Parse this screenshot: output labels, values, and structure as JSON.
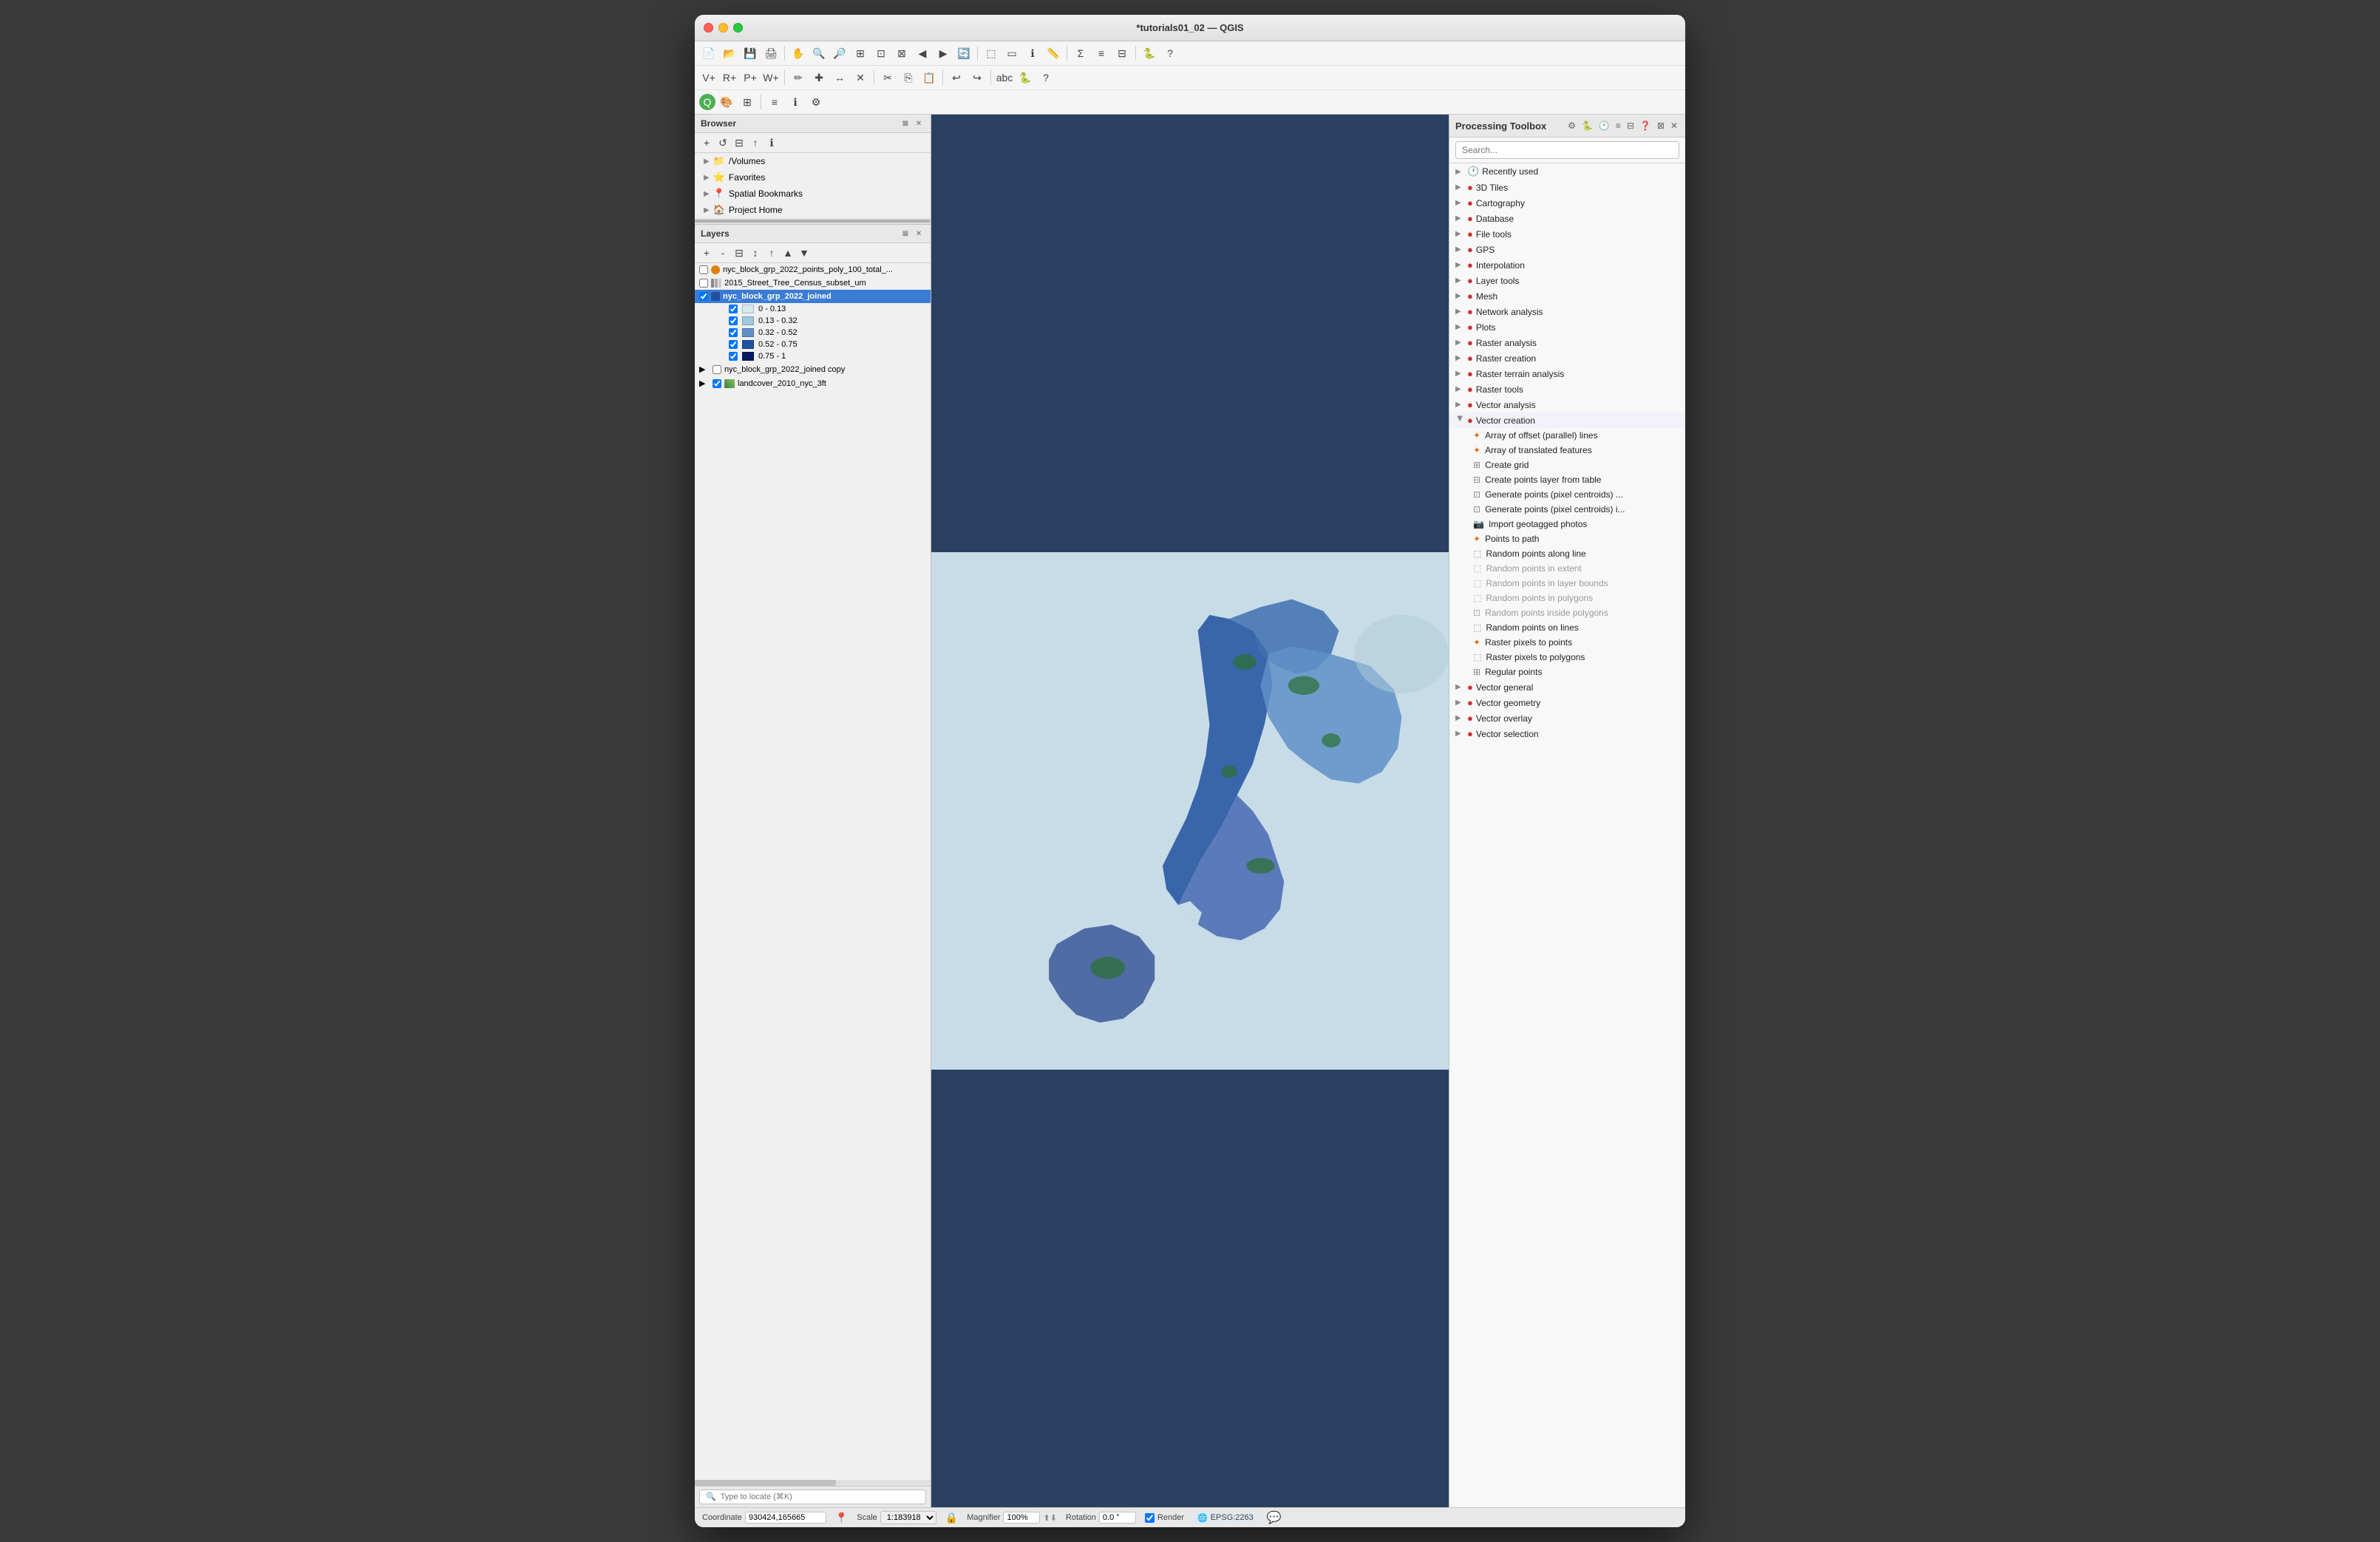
{
  "window": {
    "title": "*tutorials01_02 — QGIS"
  },
  "toolbar": {
    "rows": [
      [
        "new",
        "open",
        "save",
        "save-as",
        "print",
        "undo",
        "redo",
        "pan",
        "zoom-in",
        "zoom-out",
        "zoom-full",
        "zoom-layer",
        "zoom-selection",
        "zoom-prev",
        "zoom-next",
        "refresh",
        "select",
        "deselect",
        "select-rect",
        "select-poly",
        "select-freehand",
        "select-radius",
        "move-feature",
        "node-tool",
        "attribute-table",
        "identify",
        "measure",
        "run-script"
      ],
      [
        "add-layer",
        "add-raster",
        "add-vector",
        "add-postgis",
        "add-wms",
        "digitize",
        "edit",
        "add-feature",
        "move",
        "delete",
        "cut",
        "copy",
        "paste",
        "undo-edit",
        "redo-edit",
        "label",
        "label-pin",
        "label-rotate",
        "label-show-hide",
        "annotations",
        "python",
        "help"
      ]
    ]
  },
  "browser": {
    "title": "Browser",
    "items": [
      {
        "label": "/Volumes",
        "icon": "📁",
        "expanded": false
      },
      {
        "label": "Favorites",
        "icon": "⭐",
        "expanded": false
      },
      {
        "label": "Spatial Bookmarks",
        "icon": "📍",
        "expanded": false
      },
      {
        "label": "Project Home",
        "icon": "🏠",
        "expanded": false
      }
    ]
  },
  "layers": {
    "title": "Layers",
    "items": [
      {
        "id": "layer1",
        "label": "nyc_block_grp_2022_points_poly_100_total_...",
        "checked": false,
        "dot": "orange",
        "indent": 0,
        "selected": false
      },
      {
        "id": "layer2",
        "label": "2015_Street_Tree_Census_subset_um",
        "checked": false,
        "dot": "dots",
        "indent": 0,
        "selected": false
      },
      {
        "id": "layer3",
        "label": "nyc_block_grp_2022_joined",
        "checked": true,
        "dot": "blue",
        "indent": 0,
        "selected": true,
        "legend": [
          {
            "label": "0 - 0.13",
            "color": "#d4e8f0"
          },
          {
            "label": "0.13 - 0.32",
            "color": "#a0c8e0"
          },
          {
            "label": "0.32 - 0.52",
            "color": "#6090c8"
          },
          {
            "label": "0.52 - 0.75",
            "color": "#2050a0"
          },
          {
            "label": "0.75 - 1",
            "color": "#0a1a60"
          }
        ]
      },
      {
        "id": "layer4",
        "label": "nyc_block_grp_2022_joined copy",
        "checked": false,
        "dot": null,
        "indent": 0,
        "selected": false
      },
      {
        "id": "layer5",
        "label": "landcover_2010_nyc_3ft",
        "checked": true,
        "dot": "raster",
        "indent": 0,
        "selected": false
      }
    ]
  },
  "processing_toolbox": {
    "title": "Processing Toolbox",
    "search_placeholder": "Search...",
    "categories": [
      {
        "label": "Recently used",
        "icon": "🕐",
        "expanded": false
      },
      {
        "label": "3D Tiles",
        "icon": "🔴",
        "expanded": false
      },
      {
        "label": "Cartography",
        "icon": "🔴",
        "expanded": false
      },
      {
        "label": "Database",
        "icon": "🔴",
        "expanded": false
      },
      {
        "label": "File tools",
        "icon": "🔴",
        "expanded": false
      },
      {
        "label": "GPS",
        "icon": "🔴",
        "expanded": false
      },
      {
        "label": "Interpolation",
        "icon": "🔴",
        "expanded": false
      },
      {
        "label": "Layer tools",
        "icon": "🔴",
        "expanded": false
      },
      {
        "label": "Mesh",
        "icon": "🔴",
        "expanded": false
      },
      {
        "label": "Network analysis",
        "icon": "🔴",
        "expanded": false
      },
      {
        "label": "Plots",
        "icon": "🔴",
        "expanded": false
      },
      {
        "label": "Raster analysis",
        "icon": "🔴",
        "expanded": false
      },
      {
        "label": "Raster creation",
        "icon": "🔴",
        "expanded": false
      },
      {
        "label": "Raster terrain analysis",
        "icon": "🔴",
        "expanded": false
      },
      {
        "label": "Raster tools",
        "icon": "🔴",
        "expanded": false
      },
      {
        "label": "Vector analysis",
        "icon": "🔴",
        "expanded": false
      },
      {
        "label": "Vector creation",
        "icon": "🔴",
        "expanded": true,
        "tools": [
          {
            "label": "Array of offset (parallel) lines",
            "star": true
          },
          {
            "label": "Array of translated features",
            "star": true
          },
          {
            "label": "Create grid",
            "star": false
          },
          {
            "label": "Create points layer from table",
            "star": false
          },
          {
            "label": "Generate points (pixel centroids) ...",
            "star": false
          },
          {
            "label": "Generate points (pixel centroids) i...",
            "star": false
          },
          {
            "label": "Import geotagged photos",
            "star": false
          },
          {
            "label": "Points to path",
            "star": true
          },
          {
            "label": "Random points along line",
            "star": false
          },
          {
            "label": "Random points in extent",
            "star": false,
            "grayed": true
          },
          {
            "label": "Random points in layer bounds",
            "star": false,
            "grayed": true
          },
          {
            "label": "Random points in polygons",
            "star": false,
            "grayed": true
          },
          {
            "label": "Random points inside polygons",
            "star": false,
            "grayed": true
          },
          {
            "label": "Random points on lines",
            "star": false
          },
          {
            "label": "Raster pixels to points",
            "star": false
          },
          {
            "label": "Raster pixels to polygons",
            "star": false
          },
          {
            "label": "Regular points",
            "star": false
          }
        ]
      },
      {
        "label": "Vector general",
        "icon": "🔴",
        "expanded": false
      },
      {
        "label": "Vector geometry",
        "icon": "🔴",
        "expanded": false
      },
      {
        "label": "Vector overlay",
        "icon": "🔴",
        "expanded": false
      },
      {
        "label": "Vector selection",
        "icon": "🔴",
        "expanded": false
      }
    ]
  },
  "statusbar": {
    "coordinate_label": "Coordinate",
    "coordinate_value": "930424,165665",
    "scale_label": "Scale",
    "scale_value": "1:183918",
    "magnifier_label": "Magnifier",
    "magnifier_value": "100%",
    "rotation_label": "Rotation",
    "rotation_value": "0.0 °",
    "render_label": "Render",
    "crs_value": "EPSG:2263",
    "messages_icon": "💬"
  }
}
